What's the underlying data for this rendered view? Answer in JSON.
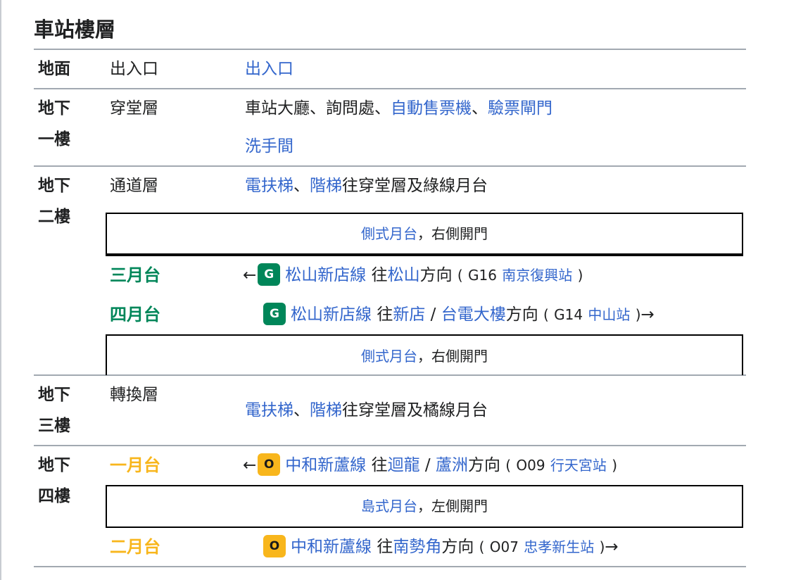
{
  "title": "車站樓層",
  "rows": {
    "ground": {
      "floor": "地面",
      "area": "出入口",
      "desc_link": "出入口"
    },
    "b1": {
      "floor_line1": "地下",
      "floor_line2": "一樓",
      "area": "穿堂層",
      "desc_text": "車站大廳、詢問處、",
      "desc_link1": "自動售票機",
      "sep": "、",
      "desc_link2": "驗票閘門",
      "desc_link3": "洗手間"
    },
    "b2": {
      "floor_line1": "地下",
      "floor_line2": "二樓",
      "area": "通道層",
      "link1": "電扶梯",
      "sep": "、",
      "link2": "階梯",
      "text": "往穿堂層及綠線月台",
      "platform_top": {
        "link": "側式月台",
        "text": "，右側開門"
      },
      "p3": {
        "label": "三月台",
        "arrow": "←",
        "badge": "G",
        "line": "松山新店線",
        "to": "往",
        "dest": "松山",
        "dir": "方向",
        "open": "(",
        "code": "G16",
        "next": "南京復興站",
        "close": ")"
      },
      "p4": {
        "label": "四月台",
        "badge": "G",
        "line": "松山新店線",
        "to": "往",
        "dest1": "新店",
        "slash": "/",
        "dest2": "台電大樓",
        "dir": "方向",
        "open": "(",
        "code": "G14",
        "next": "中山站",
        "close": ")",
        "arrow": "→"
      },
      "platform_bottom": {
        "link": "側式月台",
        "text": "，右側開門"
      }
    },
    "b3": {
      "floor_line1": "地下",
      "floor_line2": "三樓",
      "area": "轉換層",
      "link1": "電扶梯",
      "sep": "、",
      "link2": "階梯",
      "text": "往穿堂層及橘線月台"
    },
    "b4": {
      "floor_line1": "地下",
      "floor_line2": "四樓",
      "p1": {
        "label": "一月台",
        "arrow": "←",
        "badge": "O",
        "line": "中和新蘆線",
        "to": "往",
        "dest1": "迴龍",
        "slash": "/",
        "dest2": "蘆洲",
        "dir": "方向",
        "open": "(",
        "code": "O09",
        "next": "行天宮站",
        "close": ")"
      },
      "platform": {
        "link": "島式月台",
        "text": "，左側開門"
      },
      "p2": {
        "label": "二月台",
        "badge": "O",
        "line": "中和新蘆線",
        "to": "往",
        "dest": "南勢角",
        "dir": "方向",
        "open": "(",
        "code": "O07",
        "next": "忠孝新生站",
        "close": ")",
        "arrow": "→"
      }
    }
  },
  "colors": {
    "link": "#3366cc",
    "green_line": "#008659",
    "orange_line": "#f8b61c",
    "rule": "#a2a9b1"
  }
}
